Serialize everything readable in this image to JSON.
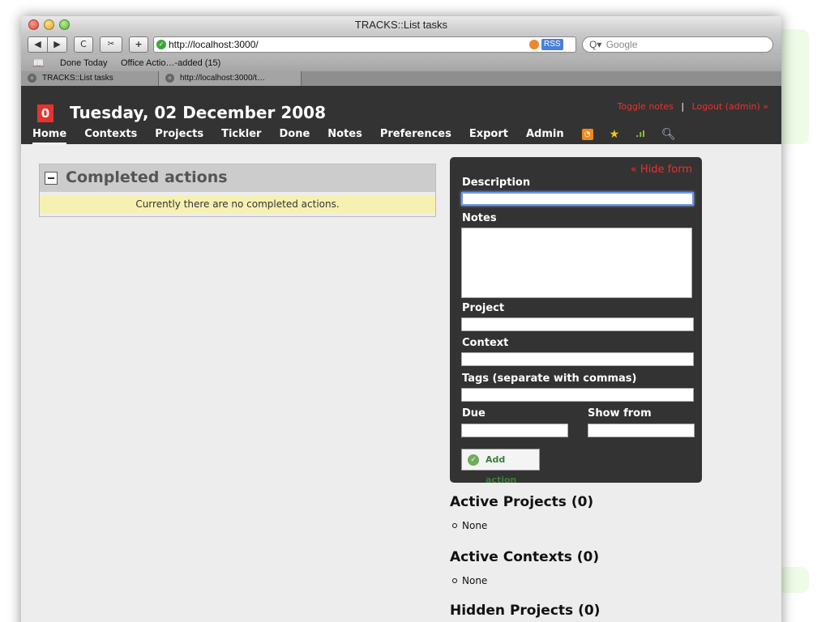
{
  "window": {
    "title": "TRACKS::List tasks"
  },
  "toolbar": {
    "back_label": "◀",
    "forward_label": "▶",
    "reload_label": "C",
    "add_label": "+",
    "url": "http://localhost:3000/",
    "rss_label": "RSS",
    "search_placeholder": "Google"
  },
  "bookmarks": {
    "items": [
      "Done Today",
      "Office Actio…-added (15)"
    ]
  },
  "tabs": [
    {
      "label": "TRACKS::List tasks"
    },
    {
      "label": "http://localhost:3000/t…"
    }
  ],
  "header": {
    "count": "0",
    "date": "Tuesday, 02 December 2008",
    "toggle_notes": "Toggle notes",
    "separator": "|",
    "logout": "Logout (admin) »",
    "nav": [
      "Home",
      "Contexts",
      "Projects",
      "Tickler",
      "Done",
      "Notes",
      "Preferences",
      "Export",
      "Admin"
    ],
    "nav_icons": [
      "rss-icon",
      "star-icon",
      "stats-icon",
      "search-icon"
    ],
    "accent_color": "#e8322d"
  },
  "completed": {
    "title": "Completed actions",
    "message": "Currently there are no completed actions."
  },
  "form": {
    "hide_label": "« Hide form",
    "description_label": "Description",
    "notes_label": "Notes",
    "project_label": "Project",
    "context_label": "Context",
    "tags_label": "Tags (separate with commas)",
    "due_label": "Due",
    "show_from_label": "Show from",
    "submit_label": "Add action"
  },
  "sidebar": {
    "active_projects": {
      "title": "Active Projects (0)",
      "items": [
        "None"
      ]
    },
    "active_contexts": {
      "title": "Active Contexts (0)",
      "items": [
        "None"
      ]
    },
    "hidden_projects": {
      "title": "Hidden Projects (0)"
    }
  }
}
